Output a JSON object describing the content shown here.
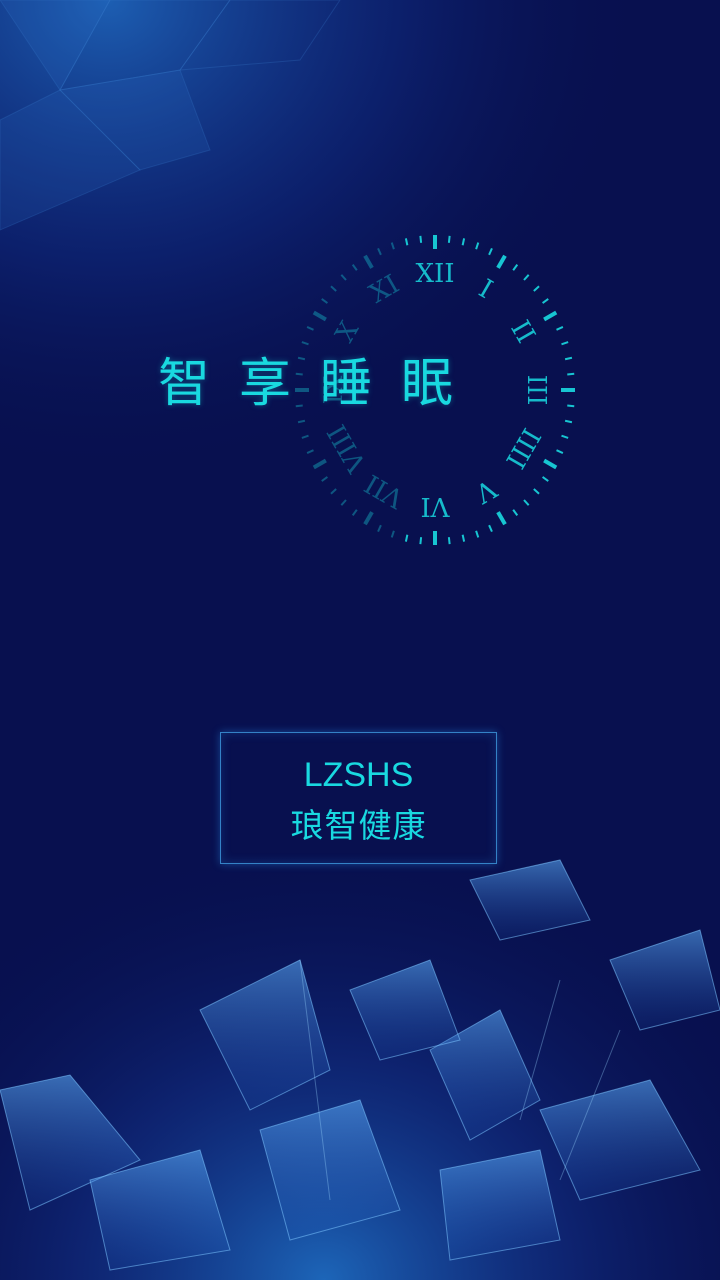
{
  "splash": {
    "slogan": "智享睡眠",
    "brand_en": "LZSHS",
    "brand_cn": "琅智健康"
  },
  "clock": {
    "numerals": [
      "XII",
      "I",
      "II",
      "III",
      "IIII",
      "V",
      "VI",
      "VII",
      "VIII",
      "IX",
      "X",
      "XI"
    ]
  },
  "colors": {
    "background": "#08104f",
    "accent": "#19d9e0",
    "frame": "#3c96dc"
  }
}
